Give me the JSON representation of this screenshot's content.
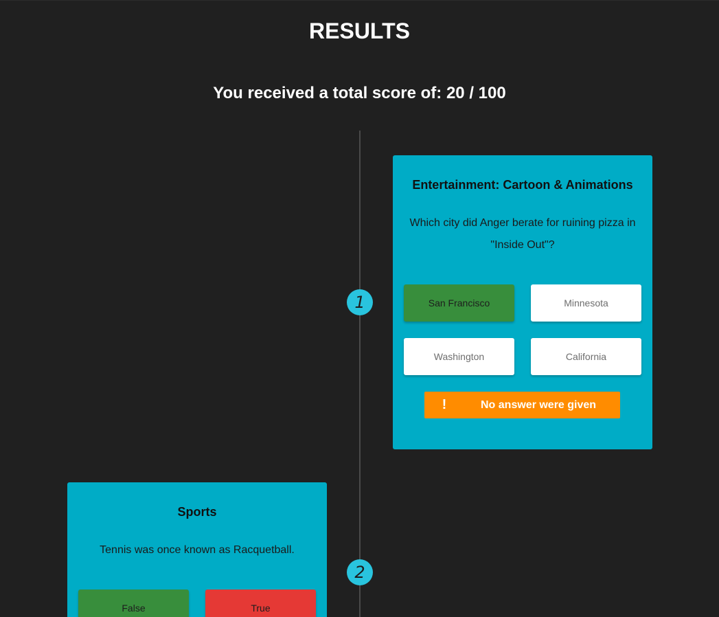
{
  "page": {
    "title": "RESULTS",
    "score_text": "You received a total score of: 20 / 100"
  },
  "questions": [
    {
      "number": "1",
      "category": "Entertainment: Cartoon & Animations",
      "question": "Which city did Anger berate for ruining pizza in \"Inside Out\"?",
      "answers": [
        {
          "label": "San Francisco",
          "state": "correct"
        },
        {
          "label": "Minnesota",
          "state": "neutral"
        },
        {
          "label": "Washington",
          "state": "neutral"
        },
        {
          "label": "California",
          "state": "neutral"
        }
      ],
      "status": {
        "icon": "!",
        "label": "No answer were given"
      }
    },
    {
      "number": "2",
      "category": "Sports",
      "question": "Tennis was once known as Racquetball.",
      "answers": [
        {
          "label": "False",
          "state": "correct"
        },
        {
          "label": "True",
          "state": "wrong"
        }
      ]
    }
  ],
  "colors": {
    "background": "#202020",
    "card": "#00acc6",
    "marker": "#29c4de",
    "correct": "#388e3c",
    "wrong": "#e53935",
    "warning": "#ff8c00",
    "answer_default": "#ffffff"
  }
}
